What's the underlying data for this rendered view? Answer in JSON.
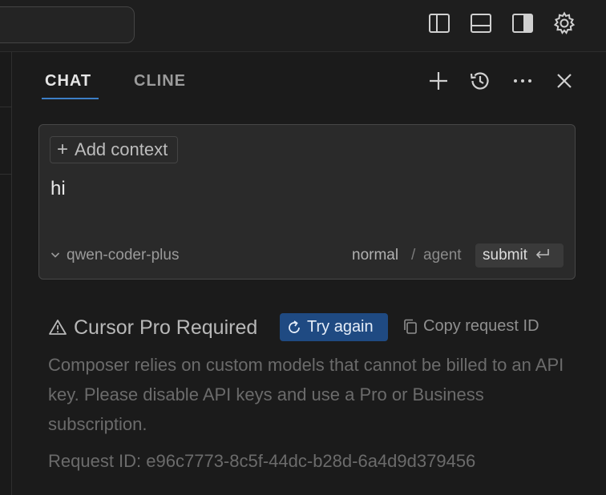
{
  "titlebar": {
    "icons": [
      "toggle-primary-sidebar-icon",
      "toggle-panel-icon",
      "toggle-secondary-sidebar-icon",
      "gear-icon"
    ]
  },
  "tabs": [
    {
      "label": "CHAT",
      "active": true
    },
    {
      "label": "CLINE",
      "active": false
    }
  ],
  "header_icons": [
    "plus-icon",
    "history-icon",
    "more-icon",
    "close-icon"
  ],
  "composer": {
    "add_context_label": "Add context",
    "input_value": "hi",
    "model": "qwen-coder-plus",
    "mode_normal": "normal",
    "mode_separator": "/",
    "mode_agent": "agent",
    "submit_label": "submit"
  },
  "error": {
    "title": "Cursor Pro Required",
    "try_again_label": "Try again",
    "copy_request_label": "Copy request ID",
    "message": "Composer relies on custom models that cannot be billed to an API key. Please disable API keys and use a Pro or Business subscription.",
    "request_id_text": "Request ID: e96c7773-8c5f-44dc-b28d-6a4d9d379456"
  },
  "colors": {
    "accent": "#3d7fc7",
    "button_blue": "#1f4a82",
    "background": "#1b1b1b"
  }
}
